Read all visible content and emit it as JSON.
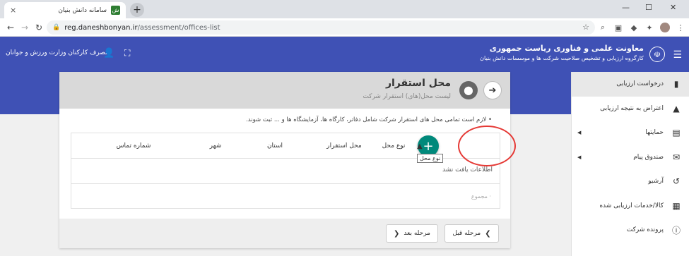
{
  "browser": {
    "tab_title": "سامانه دانش بنیان",
    "favicon_glyph": "ش",
    "tab_close": "×",
    "new_tab": "+",
    "minimize": "—",
    "maximize": "☐",
    "close": "✕",
    "url_domain": "reg.daneshbonyan.ir",
    "url_path": "/assessment/offices-list",
    "icons": [
      "back-icon",
      "forward-icon",
      "reload-icon",
      "lock-icon",
      "star-icon",
      "search-icon",
      "extension-icon",
      "puzzle-icon",
      "avatar-icon",
      "menu-icon"
    ]
  },
  "header": {
    "org_title": "معاونت علمی و فناوری ریاست جمهوری",
    "org_subtitle": "کارگروه ارزیابی و تشخیص صلاحیت شرکت ها و موسسات دانش بنیان",
    "user_name": "مصرف کارکنان وزارت ورزش و جوانان",
    "color": "#3f51b5"
  },
  "sidebar": {
    "items": [
      {
        "label": "درخواست ارزیابی",
        "icon": "bar-chart-icon",
        "active": true
      },
      {
        "label": "اعتراض به نتیجه ارزیابی",
        "icon": "warning-icon"
      },
      {
        "label": "حمایتها",
        "icon": "briefcase-icon",
        "caret": true
      },
      {
        "label": "صندوق پیام",
        "icon": "mail-icon",
        "caret": true
      },
      {
        "label": "آرشیو",
        "icon": "history-icon"
      },
      {
        "label": "کالا/خدمات ارزیابی شده",
        "icon": "calendar-icon"
      },
      {
        "label": "پرونده شرکت",
        "icon": "info-icon"
      }
    ]
  },
  "card": {
    "title": "محل استقرار",
    "subtitle": "لیست محل(های) استقرار شرکت",
    "note": "لازم است تمامی محل های استقرار شرکت شامل دفاتر، کارگاه ها، آزمایشگاه ها و ... ثبت شوند.",
    "columns": [
      "نوع محل",
      "محل استقرار",
      "استان",
      "شهر",
      "شماره تماس"
    ],
    "empty_message": "اطلاعات یافت نشد",
    "sum_label": "مجموع",
    "tooltip": "نوع محل",
    "prev_button": "مرحله قبل",
    "next_button": "مرحله بعد"
  }
}
